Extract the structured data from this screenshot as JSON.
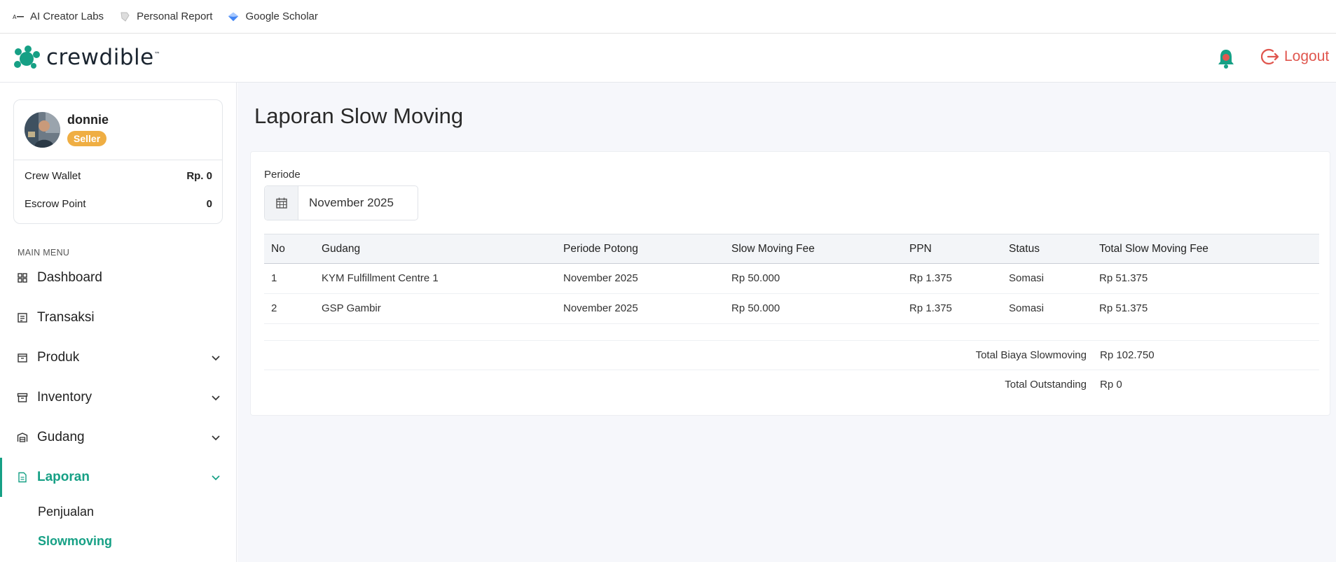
{
  "bookmarks": [
    {
      "label": "AI Creator Labs",
      "icon": "ai-creator-labs-icon"
    },
    {
      "label": "Personal Report",
      "icon": "personal-report-icon"
    },
    {
      "label": "Google Scholar",
      "icon": "google-scholar-icon"
    }
  ],
  "header": {
    "logo_text": "crewdible",
    "logo_tm": "™",
    "logout_label": "Logout"
  },
  "profile": {
    "name": "donnie",
    "role": "Seller",
    "wallet_label": "Crew Wallet",
    "wallet_value": "Rp. 0",
    "escrow_label": "Escrow Point",
    "escrow_value": "0"
  },
  "menu": {
    "title": "MAIN MENU",
    "items": [
      {
        "label": "Dashboard"
      },
      {
        "label": "Transaksi"
      },
      {
        "label": "Produk"
      },
      {
        "label": "Inventory"
      },
      {
        "label": "Gudang"
      },
      {
        "label": "Laporan"
      }
    ],
    "sub_items": [
      {
        "label": "Penjualan"
      },
      {
        "label": "Slowmoving"
      }
    ]
  },
  "page": {
    "title": "Laporan Slow Moving",
    "periode_label": "Periode",
    "periode_value": "November 2025"
  },
  "table": {
    "columns": [
      "No",
      "Gudang",
      "Periode Potong",
      "Slow Moving Fee",
      "PPN",
      "Status",
      "Total Slow Moving Fee"
    ],
    "rows": [
      [
        "1",
        "KYM Fulfillment Centre 1",
        "November 2025",
        "Rp 50.000",
        "Rp 1.375",
        "Somasi",
        "Rp 51.375"
      ],
      [
        "2",
        "GSP Gambir",
        "November 2025",
        "Rp 50.000",
        "Rp 1.375",
        "Somasi",
        "Rp 51.375"
      ]
    ],
    "total_biaya_label": "Total Biaya Slowmoving",
    "total_biaya_value": "Rp 102.750",
    "total_outstanding_label": "Total Outstanding",
    "total_outstanding_value": "Rp 0"
  },
  "colors": {
    "accent": "#16a085",
    "logout": "#e0574f",
    "badge": "#efae43"
  }
}
